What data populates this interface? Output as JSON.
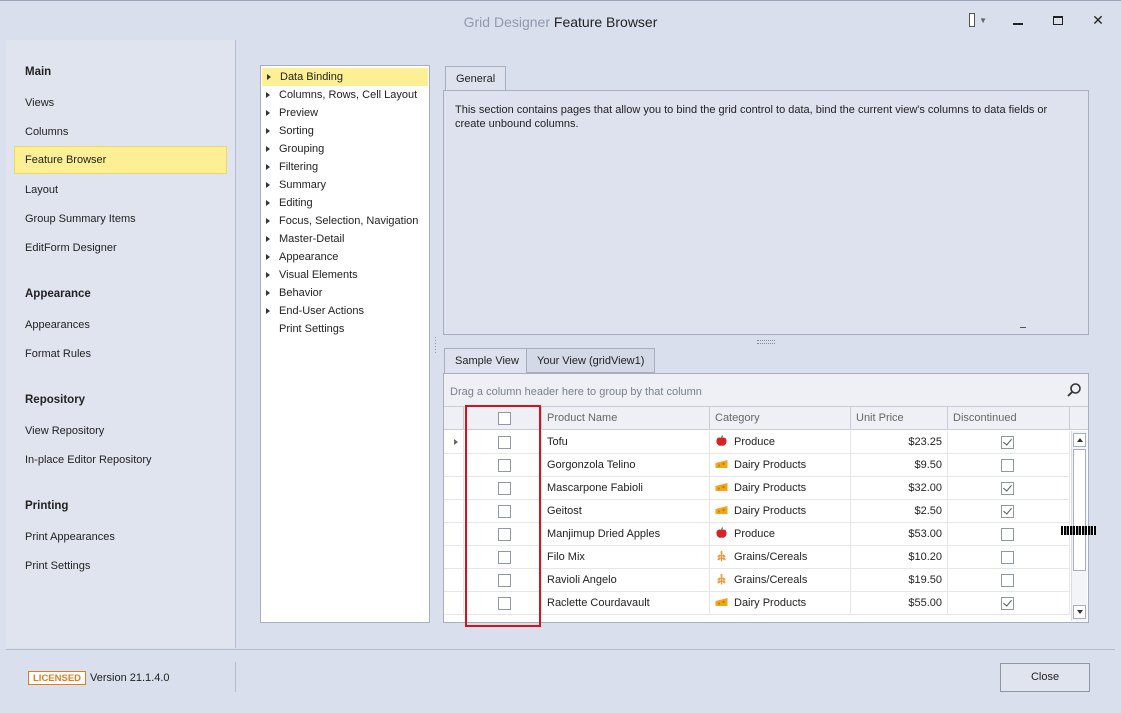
{
  "window": {
    "title_muted": "Grid Designer",
    "title_main": "Feature Browser",
    "controls": {
      "skin_icon": "palette-grid-icon",
      "minimize": "minimize-icon",
      "maximize": "maximize-icon",
      "close": "close-icon"
    }
  },
  "sidebar": {
    "groups": [
      {
        "label": "Main",
        "items": [
          "Views",
          "Columns",
          "Feature Browser",
          "Layout",
          "Group Summary Items",
          "EditForm Designer"
        ]
      },
      {
        "label": "Appearance",
        "items": [
          "Appearances",
          "Format Rules"
        ]
      },
      {
        "label": "Repository",
        "items": [
          "View Repository",
          "In-place Editor Repository"
        ]
      },
      {
        "label": "Printing",
        "items": [
          "Print Appearances",
          "Print Settings"
        ]
      }
    ],
    "selected": "Feature Browser"
  },
  "tree": {
    "items": [
      {
        "label": "Data Binding",
        "expandable": true,
        "selected": true
      },
      {
        "label": "Columns, Rows, Cell Layout",
        "expandable": true
      },
      {
        "label": "Preview",
        "expandable": true
      },
      {
        "label": "Sorting",
        "expandable": true
      },
      {
        "label": "Grouping",
        "expandable": true
      },
      {
        "label": "Filtering",
        "expandable": true
      },
      {
        "label": "Summary",
        "expandable": true
      },
      {
        "label": "Editing",
        "expandable": true
      },
      {
        "label": "Focus, Selection, Navigation",
        "expandable": true
      },
      {
        "label": "Master-Detail",
        "expandable": true
      },
      {
        "label": "Appearance",
        "expandable": true
      },
      {
        "label": "Visual Elements",
        "expandable": true
      },
      {
        "label": "Behavior",
        "expandable": true
      },
      {
        "label": "End-User Actions",
        "expandable": true
      },
      {
        "label": "Print Settings",
        "expandable": false
      }
    ]
  },
  "general": {
    "tab_label": "General",
    "description": "This section contains pages that allow you to bind the grid control to data, bind the current view's columns to data fields or create unbound columns."
  },
  "view_tabs": {
    "sample": "Sample View",
    "yours": "Your View (gridView1)"
  },
  "grid": {
    "group_panel_text": "Drag a column header here to group by that column",
    "columns": [
      "",
      "Product Name",
      "Category",
      "Unit Price",
      "Discontinued"
    ],
    "rows": [
      {
        "product": "Tofu",
        "category": "Produce",
        "cat_icon": "apple-icon",
        "price": "$23.25",
        "discontinued": true,
        "focused": true
      },
      {
        "product": "Gorgonzola Telino",
        "category": "Dairy Products",
        "cat_icon": "cheese-icon",
        "price": "$9.50",
        "discontinued": false
      },
      {
        "product": "Mascarpone Fabioli",
        "category": "Dairy Products",
        "cat_icon": "cheese-icon",
        "price": "$32.00",
        "discontinued": true
      },
      {
        "product": "Geitost",
        "category": "Dairy Products",
        "cat_icon": "cheese-icon",
        "price": "$2.50",
        "discontinued": true
      },
      {
        "product": "Manjimup Dried Apples",
        "category": "Produce",
        "cat_icon": "apple-icon",
        "price": "$53.00",
        "discontinued": false
      },
      {
        "product": "Filo Mix",
        "category": "Grains/Cereals",
        "cat_icon": "wheat-icon",
        "price": "$10.20",
        "discontinued": false
      },
      {
        "product": "Ravioli Angelo",
        "category": "Grains/Cereals",
        "cat_icon": "wheat-icon",
        "price": "$19.50",
        "discontinued": false
      },
      {
        "product": "Raclette Courdavault",
        "category": "Dairy Products",
        "cat_icon": "cheese-icon",
        "price": "$55.00",
        "discontinued": true
      }
    ]
  },
  "footer": {
    "license_badge": "LICENSED",
    "version": "Version 21.1.4.0",
    "close_label": "Close"
  },
  "colors": {
    "selection": "#fdef93",
    "highlight_box": "#d0141b",
    "license": "#e27b1c"
  }
}
